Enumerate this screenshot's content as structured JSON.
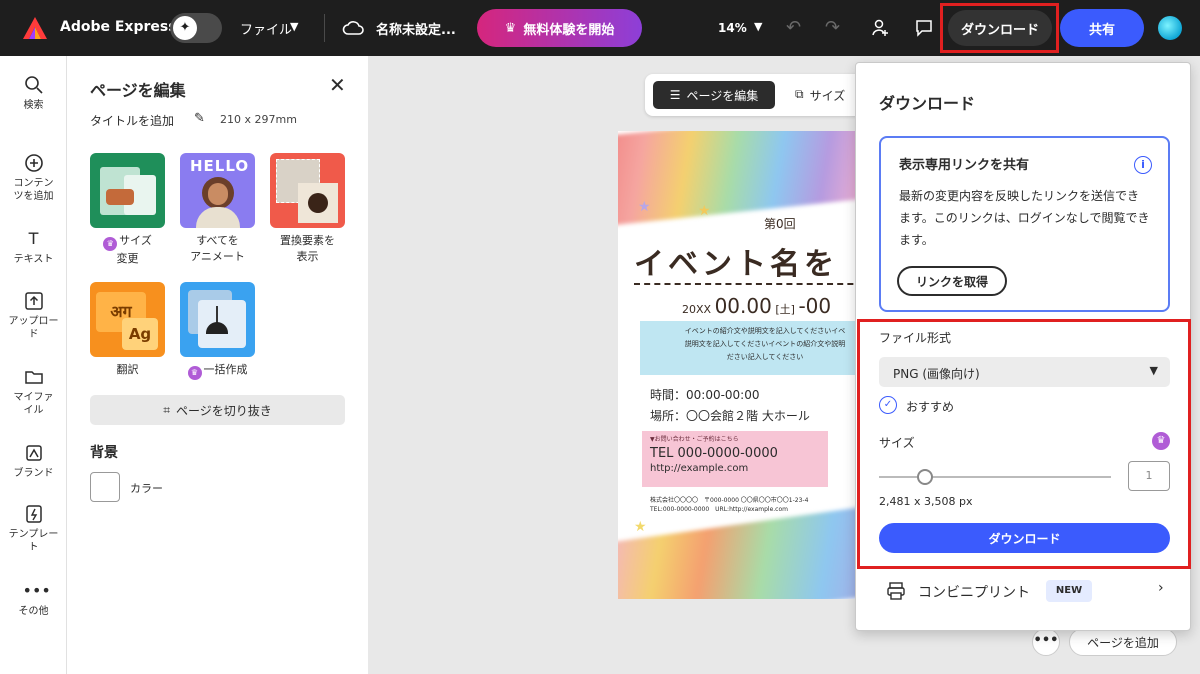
{
  "header": {
    "app_name": "Adobe Express",
    "file_menu": "ファイル",
    "doc_name": "名称未設定...",
    "trial_button": "無料体験を開始",
    "zoom": "14%",
    "download_button": "ダウンロード",
    "share_button": "共有",
    "accent_color": "#3b5bfd",
    "highlight_color": "#e02020"
  },
  "rail": {
    "items": [
      {
        "icon": "search-icon",
        "label": "検索"
      },
      {
        "icon": "plus-circle-icon",
        "label": "コンテンツを追加"
      },
      {
        "icon": "text-icon",
        "label": "テキスト"
      },
      {
        "icon": "upload-icon",
        "label": "アップロード"
      },
      {
        "icon": "folder-icon",
        "label": "マイファイル"
      },
      {
        "icon": "brand-icon",
        "label": "ブランド"
      },
      {
        "icon": "template-icon",
        "label": "テンプレート"
      },
      {
        "icon": "more-icon",
        "label": "その他"
      }
    ]
  },
  "panel": {
    "title": "ページを編集",
    "add_title": "タイトルを追加",
    "page_size": "210 x 297mm",
    "tiles": [
      {
        "label_line1": "サイズ",
        "label_line2": "変更",
        "premium": true
      },
      {
        "label_line1": "すべてを",
        "label_line2": "アニメート",
        "premium": false
      },
      {
        "label_line1": "置換要素を",
        "label_line2": "表示",
        "premium": false
      },
      {
        "label_line1": "翻訳",
        "label_line2": "",
        "premium": false
      },
      {
        "label_line1": "一括作成",
        "label_line2": "",
        "premium": true
      }
    ],
    "tile_texts": {
      "hello": "HELLO",
      "translate_a": "अग",
      "translate_b": "Ag"
    },
    "crop_button": "ページを切り抜き",
    "background_title": "背景",
    "color_label": "カラー"
  },
  "canvas": {
    "edit_page_tab": "ページを編集",
    "resize_tab": "サイズ",
    "more_button": "•••",
    "add_page_button": "ページを追加",
    "flyer": {
      "issue": "第0回",
      "title": "イベント名を",
      "date_prefix": "20XX",
      "date_main": "00.00",
      "date_day": "[土]",
      "date_suffix": "-00",
      "intro_line1": "イベントの紹介文や説明文を記入してくださいイベ",
      "intro_line2": "説明文を記入してくださいイベントの紹介文や説明",
      "intro_line3": "ださい記入してください",
      "time": "時間：00:00-00:00",
      "place": "場所：〇〇会館２階 大ホール",
      "contact_header": "▼お問い合わせ・ご予約はこちら",
      "tel": "TEL 000-0000-0000",
      "url": "http://example.com",
      "small1": "株式会社〇〇〇〇　〒000-0000 〇〇県〇〇市〇〇1-23-4",
      "small2": "TEL:000-0000-0000　URL:http://example.com"
    }
  },
  "download_panel": {
    "title": "ダウンロード",
    "share_card": {
      "title": "表示専用リンクを共有",
      "description": "最新の変更内容を反映したリンクを送信できます。このリンクは、ログインなしで閲覧できます。",
      "button": "リンクを取得"
    },
    "file_format_label": "ファイル形式",
    "file_format_value": "PNG (画像向け)",
    "recommended_label": "おすすめ",
    "size_label": "サイズ",
    "size_value": "1",
    "size_slider_fraction": 0.2,
    "dimensions": "2,481 x 3,508 px",
    "download_button": "ダウンロード",
    "print_label": "コンビニプリント",
    "print_badge": "NEW"
  }
}
